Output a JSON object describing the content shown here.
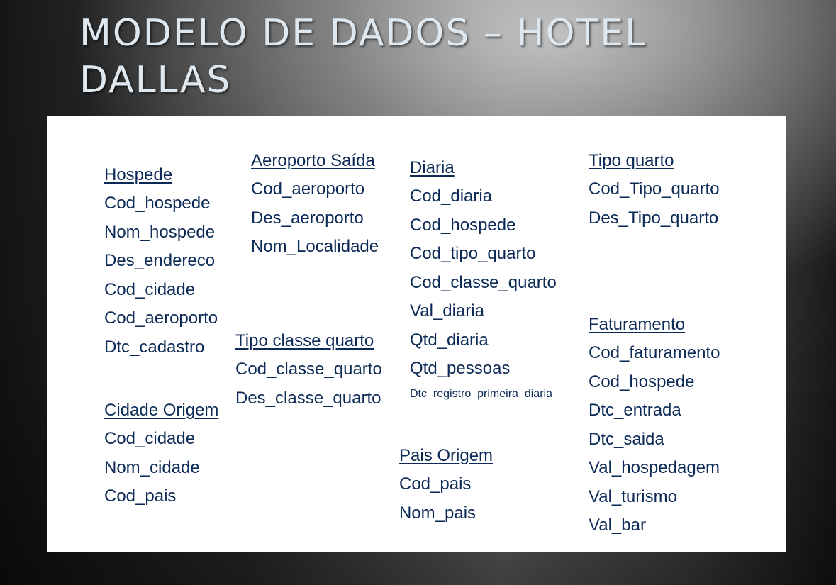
{
  "slide": {
    "title_line1": "MODELO DE DADOS – HOTEL",
    "title_line2": "DALLAS"
  },
  "entities": {
    "hospede": {
      "name": "Hospede",
      "fields": [
        "Cod_hospede",
        "Nom_hospede",
        "Des_endereco",
        "Cod_cidade",
        "Cod_aeroporto",
        "Dtc_cadastro"
      ]
    },
    "cidade_origem": {
      "name": "Cidade Origem",
      "fields": [
        "Cod_cidade",
        "Nom_cidade",
        "Cod_pais"
      ]
    },
    "aeroporto_saida": {
      "name": "Aeroporto Saída",
      "fields": [
        "Cod_aeroporto",
        "Des_aeroporto",
        "Nom_Localidade"
      ]
    },
    "tipo_classe_quarto": {
      "name": "Tipo classe quarto",
      "fields": [
        "Cod_classe_quarto",
        "Des_classe_quarto"
      ]
    },
    "diaria": {
      "name": "Diaria",
      "fields": [
        "Cod_diaria",
        "Cod_hospede",
        "Cod_tipo_quarto",
        "Cod_classe_quarto",
        "Val_diaria",
        "Qtd_diaria",
        "Qtd_pessoas",
        "Dtc_registro_primeira_diaria"
      ]
    },
    "pais_origem": {
      "name": "Pais Origem",
      "fields": [
        "Cod_pais",
        "Nom_pais"
      ]
    },
    "tipo_quarto": {
      "name": "Tipo quarto",
      "fields": [
        "Cod_Tipo_quarto",
        "Des_Tipo_quarto"
      ]
    },
    "faturamento": {
      "name": "Faturamento",
      "fields": [
        "Cod_faturamento",
        "Cod_hospede",
        "Dtc_entrada",
        "Dtc_saida",
        "Val_hospedagem",
        "Val_turismo",
        "Val_bar"
      ]
    }
  }
}
